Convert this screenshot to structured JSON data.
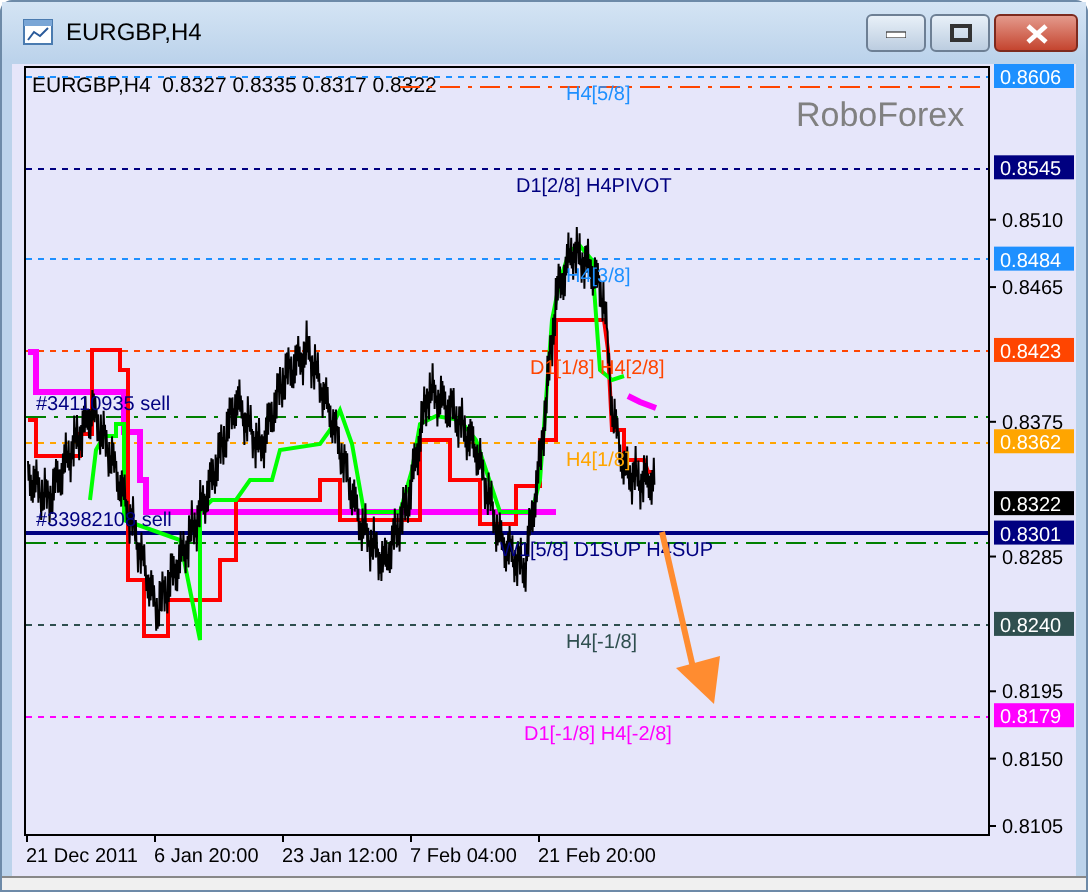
{
  "window": {
    "title": "EURGBP,H4"
  },
  "chart": {
    "header": "EURGBP,H4  0.8327 0.8335 0.8317 0.8322",
    "watermark": "RoboForex",
    "levels": [
      {
        "label": "H4[5/8]",
        "tag": "0.8606",
        "color": "#1e90ff"
      },
      {
        "label": "D1[2/8] H4PIVOT",
        "tag": "0.8545",
        "color": "#000080"
      },
      {
        "label": "H4[3/8]",
        "tag": "0.8484",
        "color": "#1e90ff"
      },
      {
        "label": "D1[1/8] H4[2/8]",
        "tag": "0.8423",
        "color": "#ff4500"
      },
      {
        "label": "H4[1/8]",
        "tag": "0.8362",
        "color": "#ffa500"
      },
      {
        "label": "W1[5/8] D1SUP H4SUP",
        "tag": "0.8301",
        "color": "#000080"
      },
      {
        "label": "H4[-1/8]",
        "tag": "0.8240",
        "color": "#2f4f4f"
      },
      {
        "label": "D1[-1/8] H4[-2/8]",
        "tag": "0.8179",
        "color": "#ff00ff"
      }
    ],
    "current_price": "0.8322",
    "orders": [
      {
        "label": "#34110935 sell"
      },
      {
        "label": "#33982108 sell"
      }
    ],
    "price_axis": [
      "0.8510",
      "0.8465",
      "0.8375",
      "0.8285",
      "0.8195",
      "0.8150",
      "0.8105"
    ],
    "time_axis": [
      "21 Dec 2011",
      "6 Jan 20:00",
      "23 Jan 12:00",
      "7 Feb 04:00",
      "21 Feb 20:00"
    ]
  }
}
